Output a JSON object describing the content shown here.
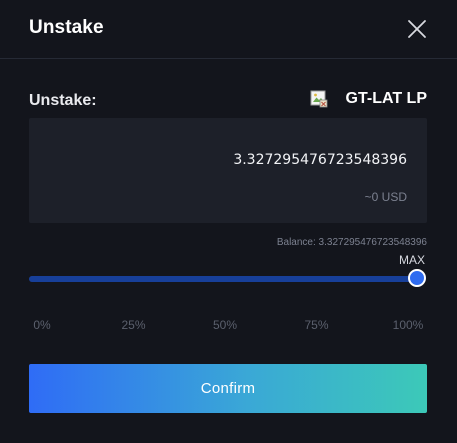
{
  "header": {
    "title": "Unstake"
  },
  "form": {
    "label": "Unstake:",
    "token_name": "GT-LAT LP",
    "token_icon": "broken-image-icon",
    "amount": "3.327295476723548396",
    "usd_value": "~0 USD",
    "balance_text": "Balance: 3.327295476723548396"
  },
  "slider": {
    "max_label": "MAX",
    "value_fraction": 1.0,
    "ticks": [
      "0%",
      "25%",
      "50%",
      "75%",
      "100%"
    ]
  },
  "actions": {
    "confirm_label": "Confirm"
  },
  "colors": {
    "background": "#13151c",
    "input_background": "#1d2029",
    "slider_fill": "#173f99",
    "thumb": "#2f6cf0",
    "button_gradient_start": "#2f6cf6",
    "button_gradient_end": "#3cc9b8"
  }
}
